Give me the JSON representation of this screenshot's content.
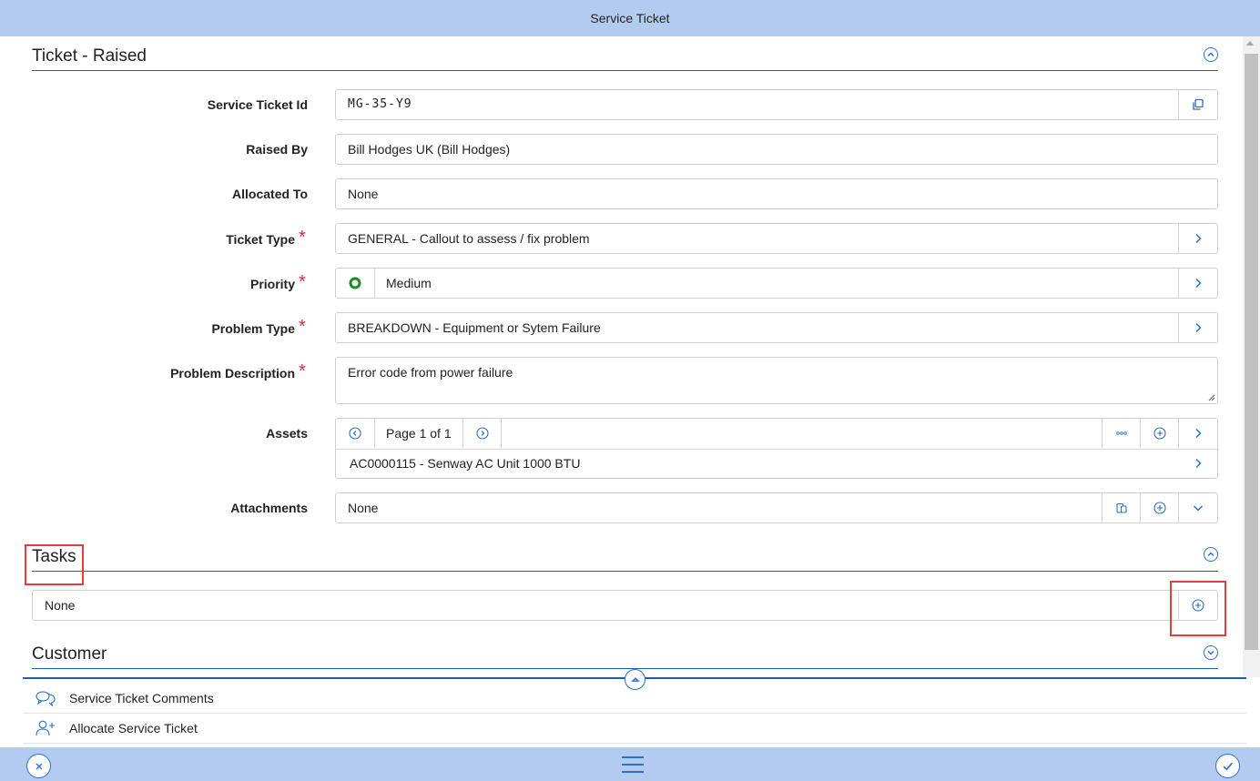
{
  "header": {
    "title": "Service Ticket"
  },
  "ticket_section": {
    "title": "Ticket  -  Raised"
  },
  "fields": {
    "service_ticket_id": {
      "label": "Service Ticket Id",
      "value": "MG-35-Y9"
    },
    "raised_by": {
      "label": "Raised By",
      "value": "Bill Hodges UK (Bill Hodges)"
    },
    "allocated_to": {
      "label": "Allocated To",
      "value": "None"
    },
    "ticket_type": {
      "label": "Ticket Type",
      "value": "GENERAL  - Callout to assess / fix problem",
      "required": "*"
    },
    "priority": {
      "label": "Priority",
      "value": "Medium",
      "required": "*",
      "status_color": "#1a8a2a"
    },
    "problem_type": {
      "label": "Problem Type",
      "value": "BREAKDOWN - Equipment or Sytem Failure",
      "required": "*"
    },
    "problem_description": {
      "label": "Problem Description",
      "value": "Error code from power failure",
      "required": "*"
    },
    "assets": {
      "label": "Assets",
      "pager": "Page 1 of 1",
      "item": "AC0000115 - Senway AC Unit 1000 BTU"
    },
    "attachments": {
      "label": "Attachments",
      "value": "None"
    }
  },
  "tasks_section": {
    "title": "Tasks",
    "value": "None"
  },
  "customer_section": {
    "title": "Customer"
  },
  "links": [
    {
      "label": "Service Ticket Comments",
      "icon": "comments-icon"
    },
    {
      "label": "Allocate Service Ticket",
      "icon": "add-user-icon"
    }
  ],
  "colors": {
    "accent": "#2a6fc9",
    "bar": "#b3cbef",
    "required": "#d9263f",
    "highlight": "#e3403b"
  }
}
